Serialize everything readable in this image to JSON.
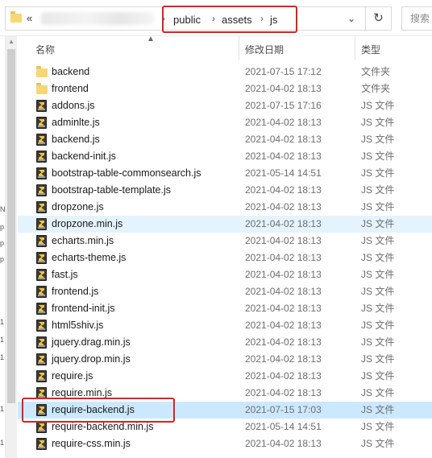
{
  "address": {
    "overflow": "«",
    "crumbs": [
      "public",
      "assets",
      "js"
    ],
    "dropdown": "⌄",
    "refresh": "↻",
    "search_placeholder": "搜索"
  },
  "nav_pane": {
    "glyphs": [
      "N",
      "p",
      "p",
      "p",
      "1",
      "1",
      "1",
      "1",
      "1"
    ]
  },
  "header": {
    "name": "名称",
    "date": "修改日期",
    "type": "类型",
    "sort_arrow": "▲"
  },
  "files": [
    {
      "name": "backend",
      "date": "2021-07-15 17:12",
      "type": "文件夹",
      "icon": "folder-icon"
    },
    {
      "name": "frontend",
      "date": "2021-04-02 18:13",
      "type": "文件夹",
      "icon": "folder-icon"
    },
    {
      "name": "addons.js",
      "date": "2021-07-15 17:16",
      "type": "JS 文件",
      "icon": "js-file-icon"
    },
    {
      "name": "adminlte.js",
      "date": "2021-04-02 18:13",
      "type": "JS 文件",
      "icon": "js-file-icon"
    },
    {
      "name": "backend.js",
      "date": "2021-04-02 18:13",
      "type": "JS 文件",
      "icon": "js-file-icon"
    },
    {
      "name": "backend-init.js",
      "date": "2021-04-02 18:13",
      "type": "JS 文件",
      "icon": "js-file-icon"
    },
    {
      "name": "bootstrap-table-commonsearch.js",
      "date": "2021-05-14 14:51",
      "type": "JS 文件",
      "icon": "js-file-icon"
    },
    {
      "name": "bootstrap-table-template.js",
      "date": "2021-04-02 18:13",
      "type": "JS 文件",
      "icon": "js-file-icon"
    },
    {
      "name": "dropzone.js",
      "date": "2021-04-02 18:13",
      "type": "JS 文件",
      "icon": "js-file-icon"
    },
    {
      "name": "dropzone.min.js",
      "date": "2021-04-02 18:13",
      "type": "JS 文件",
      "icon": "js-file-icon"
    },
    {
      "name": "echarts.min.js",
      "date": "2021-04-02 18:13",
      "type": "JS 文件",
      "icon": "js-file-icon"
    },
    {
      "name": "echarts-theme.js",
      "date": "2021-04-02 18:13",
      "type": "JS 文件",
      "icon": "js-file-icon"
    },
    {
      "name": "fast.js",
      "date": "2021-04-02 18:13",
      "type": "JS 文件",
      "icon": "js-file-icon"
    },
    {
      "name": "frontend.js",
      "date": "2021-04-02 18:13",
      "type": "JS 文件",
      "icon": "js-file-icon"
    },
    {
      "name": "frontend-init.js",
      "date": "2021-04-02 18:13",
      "type": "JS 文件",
      "icon": "js-file-icon"
    },
    {
      "name": "html5shiv.js",
      "date": "2021-04-02 18:13",
      "type": "JS 文件",
      "icon": "js-file-icon"
    },
    {
      "name": "jquery.drag.min.js",
      "date": "2021-04-02 18:13",
      "type": "JS 文件",
      "icon": "js-file-icon"
    },
    {
      "name": "jquery.drop.min.js",
      "date": "2021-04-02 18:13",
      "type": "JS 文件",
      "icon": "js-file-icon"
    },
    {
      "name": "require.js",
      "date": "2021-04-02 18:13",
      "type": "JS 文件",
      "icon": "js-file-icon"
    },
    {
      "name": "require.min.js",
      "date": "2021-04-02 18:13",
      "type": "JS 文件",
      "icon": "js-file-icon"
    },
    {
      "name": "require-backend.js",
      "date": "2021-07-15 17:03",
      "type": "JS 文件",
      "icon": "js-file-icon",
      "state": "selected"
    },
    {
      "name": "require-backend.min.js",
      "date": "2021-05-14 14:51",
      "type": "JS 文件",
      "icon": "js-file-icon"
    },
    {
      "name": "require-css.min.js",
      "date": "2021-04-02 18:13",
      "type": "JS 文件",
      "icon": "js-file-icon"
    }
  ],
  "hover_row": "dropzone.min.js",
  "colors": {
    "selected": "#cce8ff",
    "hover": "#e5f3ff",
    "annotation": "#e02020"
  }
}
